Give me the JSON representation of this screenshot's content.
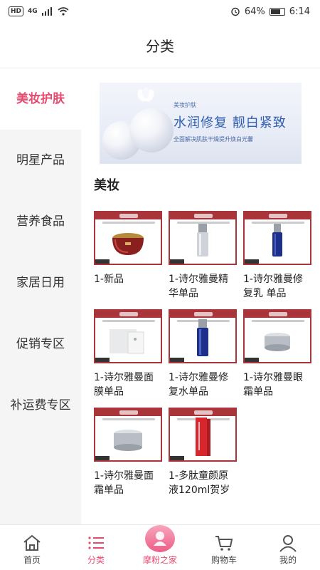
{
  "status_bar": {
    "left": "HD",
    "signal": "4G",
    "battery": "64%",
    "time": "6:14"
  },
  "header": {
    "title": "分类"
  },
  "sidebar": {
    "items": [
      {
        "label": "美妆护肤",
        "active": true
      },
      {
        "label": "明星产品",
        "active": false
      },
      {
        "label": "营养食品",
        "active": false
      },
      {
        "label": "家居日用",
        "active": false
      },
      {
        "label": "促销专区",
        "active": false
      },
      {
        "label": "补运费专区",
        "active": false
      }
    ]
  },
  "banner": {
    "small": "美妆护肤",
    "title": "水润修复 靓白紧致",
    "subtitle": "全面解决肌肤干燥提升焕白光馨"
  },
  "section": {
    "title": "美妆"
  },
  "products": [
    {
      "name": "1-新品",
      "image": "red-gold-jar"
    },
    {
      "name": "1-诗尔雅曼精华单品",
      "image": "silver-serum-bottle"
    },
    {
      "name": "1-诗尔雅曼修复乳 单品",
      "image": "blue-lotion-bottle"
    },
    {
      "name": "1-诗尔雅曼面膜单品",
      "image": "white-mask-box"
    },
    {
      "name": "1-诗尔雅曼修复水单品",
      "image": "blue-toner-bottle"
    },
    {
      "name": "1-诗尔雅曼眼霜单品",
      "image": "silver-eye-cream-jar"
    },
    {
      "name": "1-诗尔雅曼面霜单品",
      "image": "silver-face-cream-jar"
    },
    {
      "name": "1-多肽童颜原液120ml贺岁",
      "image": "red-essence-box"
    }
  ],
  "tabbar": {
    "items": [
      {
        "label": "首页",
        "icon": "home-icon",
        "active": false
      },
      {
        "label": "分类",
        "icon": "category-icon",
        "active": true
      },
      {
        "label": "摩粉之家",
        "icon": "fan-home-icon",
        "active": false
      },
      {
        "label": "购物车",
        "icon": "cart-icon",
        "active": false
      },
      {
        "label": "我的",
        "icon": "user-icon",
        "active": false
      }
    ]
  },
  "colors": {
    "accent": "#e64a6f",
    "card_border": "#a9343a",
    "sidebar_bg": "#f5f5f5"
  }
}
